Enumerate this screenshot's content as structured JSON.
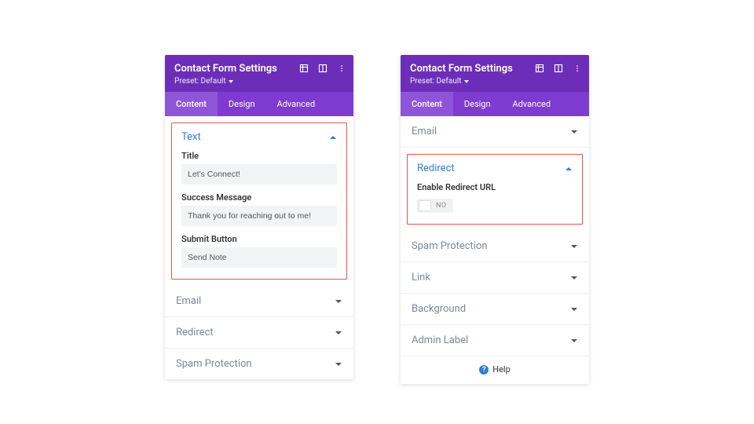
{
  "header": {
    "title": "Contact Form Settings",
    "preset_label": "Preset: Default"
  },
  "tabs": {
    "content": "Content",
    "design": "Design",
    "advanced": "Advanced"
  },
  "left": {
    "text_section": {
      "heading": "Text",
      "title_label": "Title",
      "title_value": "Let's Connect!",
      "success_label": "Success Message",
      "success_value": "Thank you for reaching out to me!",
      "submit_label": "Submit Button",
      "submit_value": "Send Note"
    },
    "collapsed": {
      "email": "Email",
      "redirect": "Redirect",
      "spam": "Spam Protection"
    }
  },
  "right": {
    "email": "Email",
    "redirect": {
      "heading": "Redirect",
      "enable_label": "Enable Redirect URL",
      "toggle_text": "NO"
    },
    "collapsed": {
      "spam": "Spam Protection",
      "link": "Link",
      "background": "Background",
      "admin": "Admin Label"
    },
    "help": "Help"
  }
}
